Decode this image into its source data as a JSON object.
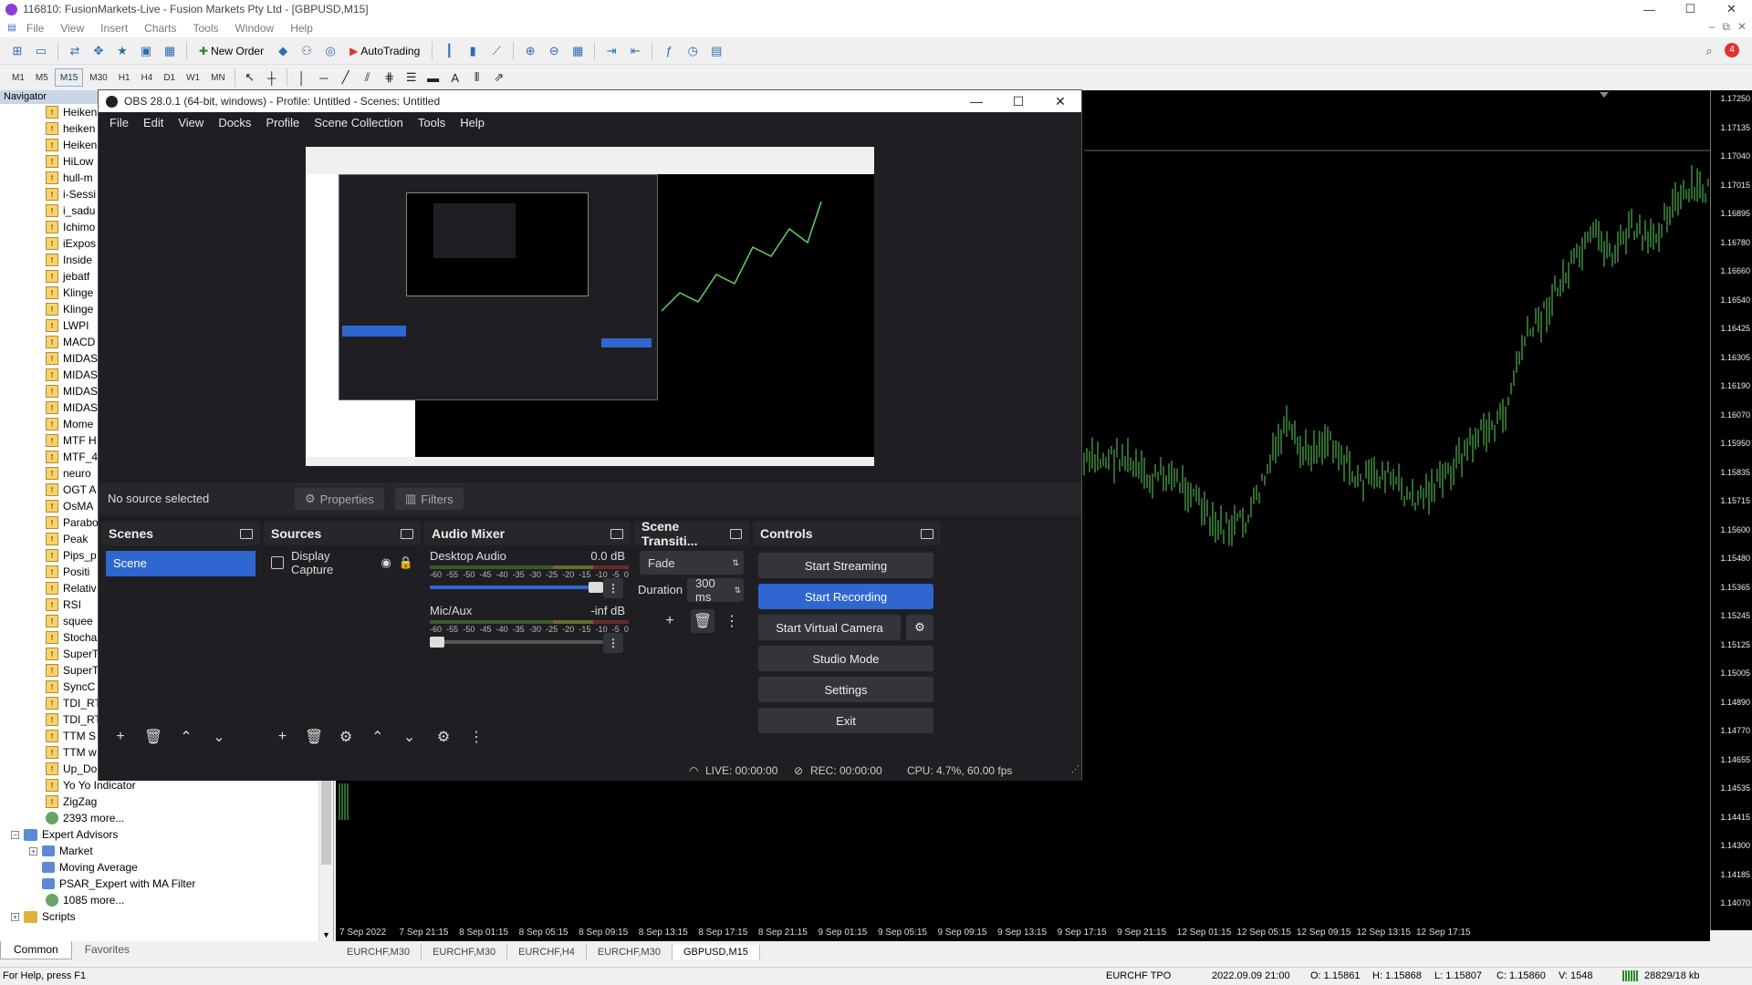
{
  "mt4": {
    "title": "116810: FusionMarkets-Live - Fusion Markets Pty Ltd - [GBPUSD,M15]",
    "menu": [
      "File",
      "View",
      "Insert",
      "Charts",
      "Tools",
      "Window",
      "Help"
    ],
    "toolbar": {
      "new_order": "New Order",
      "auto_trading": "AutoTrading"
    },
    "timeframes": [
      "M1",
      "M5",
      "M15",
      "M30",
      "H1",
      "H4",
      "D1",
      "W1",
      "MN"
    ],
    "navigator": {
      "title": "Navigator",
      "indicators": [
        "Heiken",
        "heiken",
        "Heiken",
        "HiLow",
        "hull-m",
        "i-Sessi",
        "i_sadu",
        "Ichimo",
        "iExpos",
        "Inside",
        "jebatf",
        "Klinge",
        "Klinge",
        "LWPI",
        "MACD",
        "MIDAS",
        "MIDAS",
        "MIDAS",
        "MIDAS",
        "Mome",
        "MTF H",
        "MTF_4",
        "neuro",
        "OGT A",
        "OsMA",
        "Parabo",
        "Peak",
        "Pips_p",
        "Positi",
        "Relativ",
        "RSI",
        "squee",
        "Stocha",
        "SuperT",
        "SuperT",
        "SyncC",
        "TDI_RT",
        "TDI_RT",
        "TTM S",
        "TTM w",
        "Up_Do",
        "Yo Yo Indicator",
        "ZigZag"
      ],
      "more1": "2393 more...",
      "expert_advisors": "Expert Advisors",
      "experts": [
        "Market",
        "Moving Average",
        "PSAR_Expert with MA Filter"
      ],
      "more2": "1085 more...",
      "scripts": "Scripts",
      "tabs": [
        "Common",
        "Favorites"
      ]
    },
    "price_scale": [
      "1.17250",
      "1.17135",
      "1.17040",
      "1.17015",
      "1.16895",
      "1.16780",
      "1.16660",
      "1.16540",
      "1.16425",
      "1.16305",
      "1.16190",
      "1.16070",
      "1.15950",
      "1.15835",
      "1.15715",
      "1.15600",
      "1.15480",
      "1.15365",
      "1.15245",
      "1.15125",
      "1.15005",
      "1.14890",
      "1.14770",
      "1.14655",
      "1.14535",
      "1.14415",
      "1.14300",
      "1.14185",
      "1.14070"
    ],
    "time_scale": [
      "7 Sep 2022",
      "7 Sep 21:15",
      "8 Sep 01:15",
      "8 Sep 05:15",
      "8 Sep 09:15",
      "8 Sep 13:15",
      "8 Sep 17:15",
      "8 Sep 21:15",
      "9 Sep 01:15",
      "9 Sep 05:15",
      "9 Sep 09:15",
      "9 Sep 13:15",
      "9 Sep 17:15",
      "9 Sep 21:15",
      "12 Sep 01:15",
      "12 Sep 05:15",
      "12 Sep 09:15",
      "12 Sep 13:15",
      "12 Sep 17:15"
    ],
    "chart_tabs": [
      "EURCHF,M30",
      "EURCHF,M30",
      "EURCHF,H4",
      "EURCHF,M30",
      "GBPUSD,M15"
    ],
    "status": {
      "help": "For Help, press F1",
      "profile": "EURCHF TPO",
      "datetime": "2022.09.09 21:00",
      "open": "O: 1.15861",
      "high": "H: 1.15868",
      "low": "L: 1.15807",
      "close": "C: 1.15860",
      "volume": "V: 1548",
      "traffic": "28829/18 kb"
    }
  },
  "obs": {
    "title": "OBS 28.0.1 (64-bit, windows) - Profile: Untitled - Scenes: Untitled",
    "menu": [
      "File",
      "Edit",
      "View",
      "Docks",
      "Profile",
      "Scene Collection",
      "Tools",
      "Help"
    ],
    "no_source": "No source selected",
    "properties": "Properties",
    "filters": "Filters",
    "scenes": {
      "title": "Scenes",
      "items": [
        "Scene"
      ]
    },
    "sources": {
      "title": "Sources",
      "items": [
        "Display Capture"
      ]
    },
    "audio_mixer": {
      "title": "Audio Mixer",
      "ticks": [
        "-60",
        "-55",
        "-50",
        "-45",
        "-40",
        "-35",
        "-30",
        "-25",
        "-20",
        "-15",
        "-10",
        "-5",
        "0"
      ],
      "channels": [
        {
          "name": "Desktop Audio",
          "db": "0.0 dB",
          "volume": 1.0
        },
        {
          "name": "Mic/Aux",
          "db": "-inf dB",
          "volume": 0.0
        }
      ]
    },
    "transitions": {
      "title": "Scene Transiti...",
      "type": "Fade",
      "duration_label": "Duration",
      "duration": "300 ms"
    },
    "controls": {
      "title": "Controls",
      "start_streaming": "Start Streaming",
      "start_recording": "Start Recording",
      "start_virtual_camera": "Start Virtual Camera",
      "studio_mode": "Studio Mode",
      "settings": "Settings",
      "exit": "Exit"
    },
    "status": {
      "live": "LIVE: 00:00:00",
      "rec": "REC: 00:00:00",
      "cpu": "CPU: 4.7%, 60.00 fps"
    }
  },
  "colors": {
    "candle": "#5fd35f",
    "obs_primary": "#2f66d0",
    "obs_bg": "#1f1f23"
  }
}
